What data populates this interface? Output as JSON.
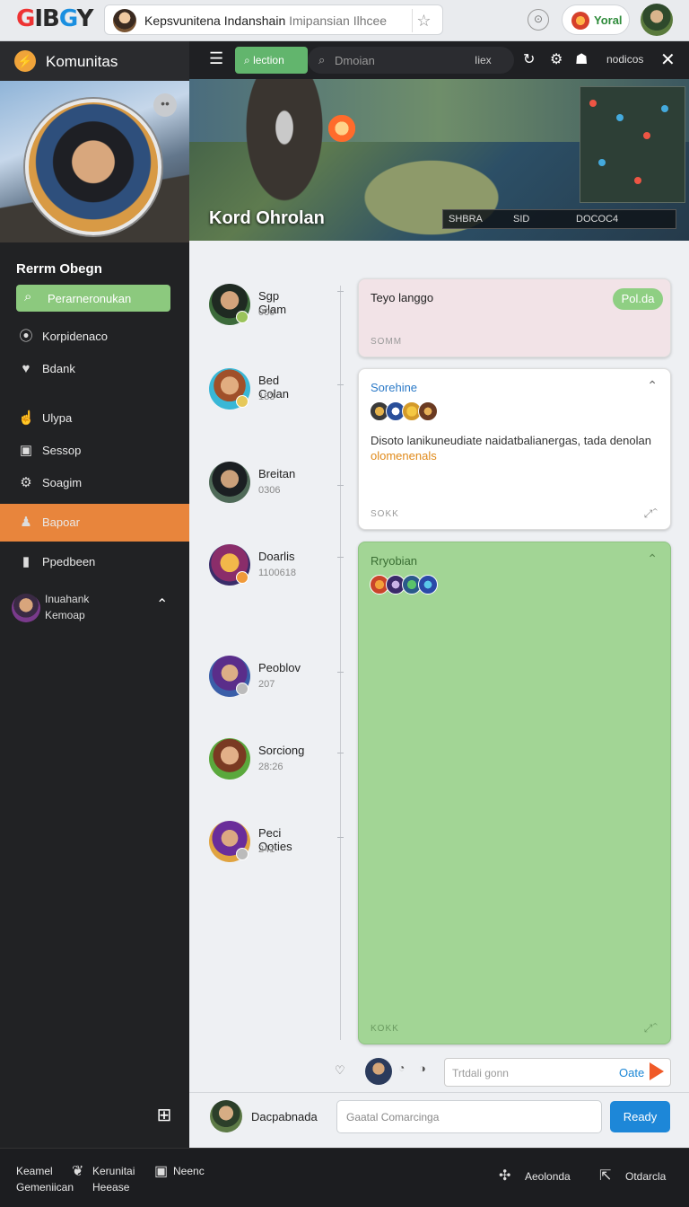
{
  "topbar": {
    "logo_text": "GIBGY",
    "url_main": "Kepsvunitena Indanshain",
    "url_sub": "Imipansian Ilhcee",
    "user_label": "Yoral"
  },
  "sidebar": {
    "header_title": "Komunitas",
    "profile_name": "Rerrm Obegn",
    "search_label": "Perarneronukan",
    "items": [
      {
        "label": "Korpidenaco",
        "icon": "pin-icon"
      },
      {
        "label": "Bdank",
        "icon": "heart-icon"
      },
      {
        "label": "Ulypa",
        "icon": "hand-icon"
      },
      {
        "label": "Sessop",
        "icon": "window-icon"
      },
      {
        "label": "Soagim",
        "icon": "gear-icon"
      },
      {
        "label": "Bapoar",
        "icon": "person-icon",
        "active": true
      },
      {
        "label": "Ppedbeen",
        "icon": "book-icon"
      }
    ],
    "user": {
      "line1": "Inuahank",
      "line2": "Kemoap"
    }
  },
  "toolbar": {
    "tab_label": "lection",
    "search_placeholder": "Dmoian",
    "search_filter": "Iiex",
    "notices_label": "nodicos"
  },
  "banner": {
    "title": "Kord Ohrolan",
    "hud_a": "SHBRA",
    "hud_b": "SID",
    "hud_c": "DOCOC4"
  },
  "friends": [
    {
      "name": "Sgp Glam",
      "sub": "000"
    },
    {
      "name": "Bed Colan",
      "sub": "183"
    },
    {
      "name": "Breitan",
      "sub": "0306"
    },
    {
      "name": "Doarlis",
      "sub": "1100618"
    },
    {
      "name": "Peoblov",
      "sub": "207"
    },
    {
      "name": "Sorciong",
      "sub": "28:26"
    },
    {
      "name": "Peci Ooties",
      "sub": "241"
    }
  ],
  "cards": {
    "card1": {
      "title": "Teyo langgo",
      "pill": "Pol.da",
      "footer": "SOMM"
    },
    "card2": {
      "title": "Sorehine",
      "body": "Disoto lanikuneudiate naidatbalianergas, tada denolan",
      "body_link": "olomenenals",
      "footer": "SOKK"
    },
    "card3": {
      "title": "Rryobian",
      "footer": "KOKK"
    }
  },
  "comment": {
    "placeholder": "Trtdali gonn",
    "send_label": "Oate"
  },
  "compose": {
    "name": "Dacpabnada",
    "placeholder": "Gaatal Comarcinga",
    "button": "Ready"
  },
  "footer": {
    "left1": "Keamel",
    "left2": "Gemeniican",
    "mid1": "Kerunitai",
    "mid2": "Heease",
    "mid3": "Neenc",
    "right1": "Aeolonda",
    "right2": "Otdarcla"
  },
  "colors": {
    "accent_orange": "#e8853c",
    "accent_green": "#8cc97e",
    "card_green": "#a2d595",
    "button_blue": "#1d87d8"
  }
}
